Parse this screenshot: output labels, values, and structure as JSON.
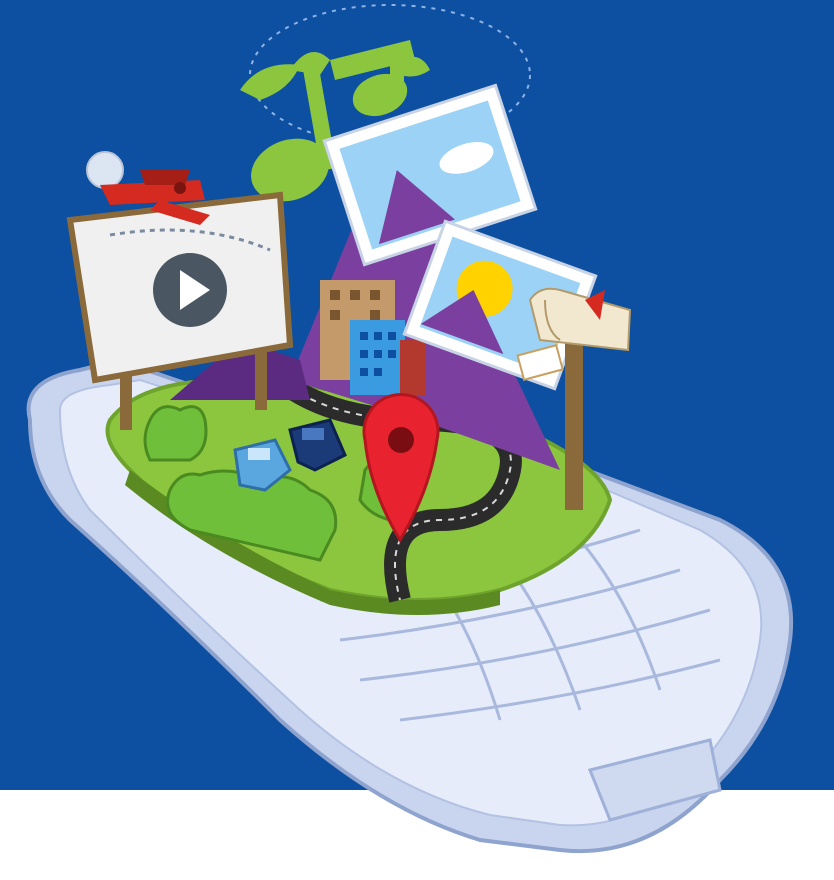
{
  "illustration": {
    "colors": {
      "background": "#0d4fa0",
      "footer": "#ffffff",
      "phone_body": "#dfe6f6",
      "phone_outline": "#9fb1d8",
      "grass": "#8cc63f",
      "road": "#2b2b2b",
      "map_pin": "#e8222e",
      "music_note": "#8cc63f",
      "mountain": "#7b3fa0",
      "airplane": "#d42a1f",
      "car_light": "#5aa7e0",
      "car_dark": "#1b3a78",
      "building_tan": "#c49a6a",
      "building_blue": "#3a9be0",
      "sign_post": "#8a6a3a"
    },
    "elements": [
      "phone-icon",
      "video-billboard-icon",
      "play-icon",
      "music-note-icon",
      "photo-icon",
      "airplane-icon",
      "map-pin-icon",
      "mailbox-icon",
      "car-icon",
      "building-icon",
      "tree-icon",
      "road"
    ]
  }
}
